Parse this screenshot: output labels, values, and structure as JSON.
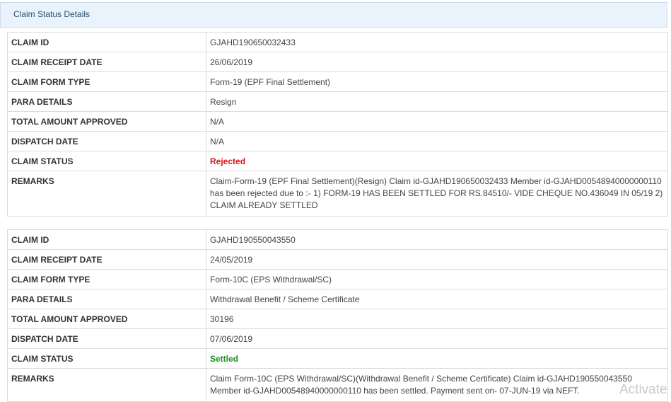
{
  "panel": {
    "title": "Claim Status Details"
  },
  "claims": [
    {
      "claim_id_label": "CLAIM ID",
      "claim_id": "GJAHD190650032433",
      "receipt_date_label": "CLAIM RECEIPT DATE",
      "receipt_date": "26/06/2019",
      "form_type_label": "CLAIM FORM TYPE",
      "form_type": "Form-19 (EPF Final Settlement)",
      "para_label": "PARA DETAILS",
      "para": "Resign",
      "amount_label": "TOTAL AMOUNT APPROVED",
      "amount": "N/A",
      "dispatch_label": "DISPATCH DATE",
      "dispatch": "N/A",
      "status_label": "CLAIM STATUS",
      "status": "Rejected",
      "status_color": "#d9121a",
      "remarks_label": "REMARKS",
      "remarks": "Claim-Form-19 (EPF Final Settlement)(Resign) Claim id-GJAHD190650032433 Member id-GJAHD00548940000000110 has been rejected due to :- 1) FORM-19 HAS BEEN SETTLED FOR RS.84510/- VIDE CHEQUE NO.436049 IN 05/19 2) CLAIM ALREADY SETTLED"
    },
    {
      "claim_id_label": "CLAIM ID",
      "claim_id": "GJAHD190550043550",
      "receipt_date_label": "CLAIM RECEIPT DATE",
      "receipt_date": "24/05/2019",
      "form_type_label": "CLAIM FORM TYPE",
      "form_type": "Form-10C (EPS Withdrawal/SC)",
      "para_label": "PARA DETAILS",
      "para": "Withdrawal Benefit / Scheme Certificate",
      "amount_label": "TOTAL AMOUNT APPROVED",
      "amount": "30196",
      "dispatch_label": "DISPATCH DATE",
      "dispatch": "07/06/2019",
      "status_label": "CLAIM STATUS",
      "status": "Settled",
      "status_color": "#1f8f1f",
      "remarks_label": "REMARKS",
      "remarks": "Claim Form-10C (EPS Withdrawal/SC)(Withdrawal Benefit / Scheme Certificate) Claim id-GJAHD190550043550 Member id-GJAHD00548940000000110 has been settled. Payment sent on- 07-JUN-19 via NEFT."
    }
  ],
  "watermark": "Activate"
}
